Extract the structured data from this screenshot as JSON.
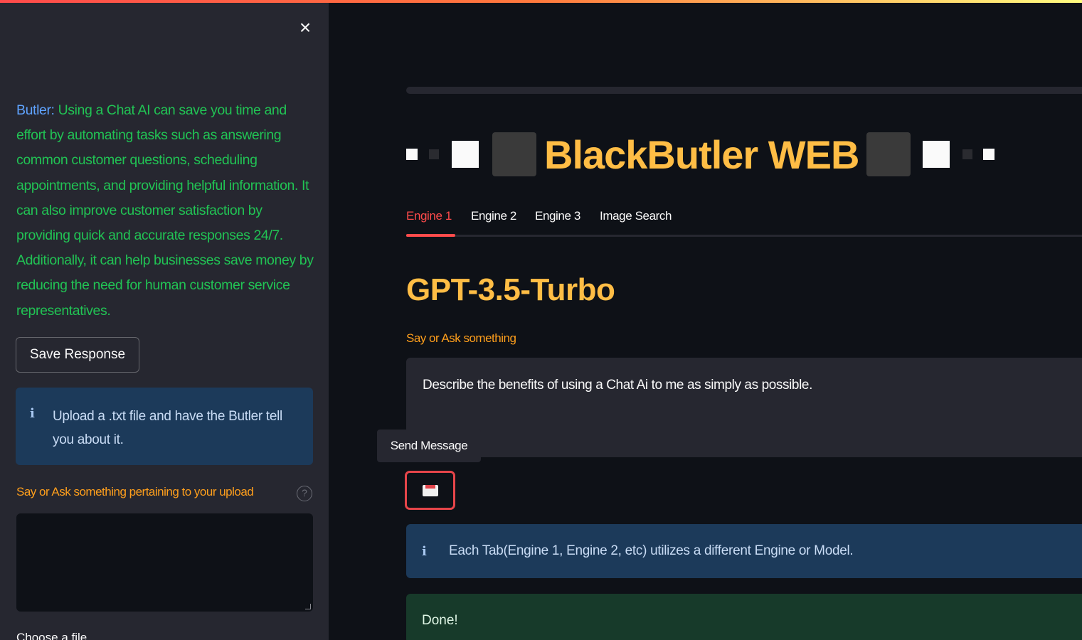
{
  "sidebar": {
    "close_label": "×",
    "butler_name": "Butler:",
    "butler_message": "Using a Chat AI can save you time and effort by automating tasks such as answering common customer questions, scheduling appointments, and providing helpful information. It can also improve customer satisfaction by providing quick and accurate responses 24/7. Additionally, it can help businesses save money by reducing the need for human customer service representatives.",
    "save_button": "Save Response",
    "info_text": "Upload a .txt file and have the Butler tell you about it.",
    "upload_label": "Say or Ask something pertaining to your upload",
    "help_symbol": "?",
    "upload_value": "",
    "choose_file": "Choose a file"
  },
  "main": {
    "title": "BlackButler WEB",
    "tabs": [
      "Engine 1",
      "Engine 2",
      "Engine 3",
      "Image Search"
    ],
    "active_tab": "Engine 1",
    "engine_heading": "GPT-3.5-Turbo",
    "prompt_label": "Say or Ask something",
    "prompt_value": "Describe the benefits of using a Chat Ai to me as simply as possible.",
    "send_tooltip": "Send Message",
    "info_text": "Each Tab(Engine 1, Engine 2, etc) utilizes a different Engine or Model.",
    "success_text": "Done!"
  },
  "icons": {
    "info": "i",
    "close": "close-icon",
    "send": "envelope-icon"
  },
  "colors": {
    "accent": "#ff4b4b",
    "title": "#ffbd45",
    "label": "#ff9f1c",
    "sidebar_text": "#21c354",
    "butler_name": "#5fa3ff"
  }
}
